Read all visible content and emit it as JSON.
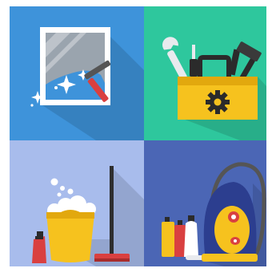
{
  "tiles": [
    {
      "key": "window-cleaning",
      "icon": "window-squeegee-icon",
      "background": "#3E93DA"
    },
    {
      "key": "repair-tools",
      "icon": "toolbox-icon",
      "background": "#2EC79D"
    },
    {
      "key": "floor-cleaning",
      "icon": "bucket-mop-icon",
      "background": "#A8BCEC"
    },
    {
      "key": "vacuuming",
      "icon": "vacuum-cleaner-icon",
      "background": "#4B66B5"
    }
  ],
  "colors": {
    "frame": "#FFFFFF",
    "glass": "#9AA4AE",
    "squeegee_blade": "#555555",
    "squeegee_handle": "#D94040",
    "toolbox": "#F6C21E",
    "toolbox_dark": "#E2A80E",
    "gear": "#2B2B2B",
    "bucket": "#F6C21E",
    "foam": "#FFFFFF",
    "mop_pole": "#2E2E2E",
    "mop_head": "#D94040",
    "bottle_red": "#D94040",
    "vacuum_body": "#2C3E8F",
    "vacuum_accent": "#F6C21E",
    "hose": "#555555"
  }
}
